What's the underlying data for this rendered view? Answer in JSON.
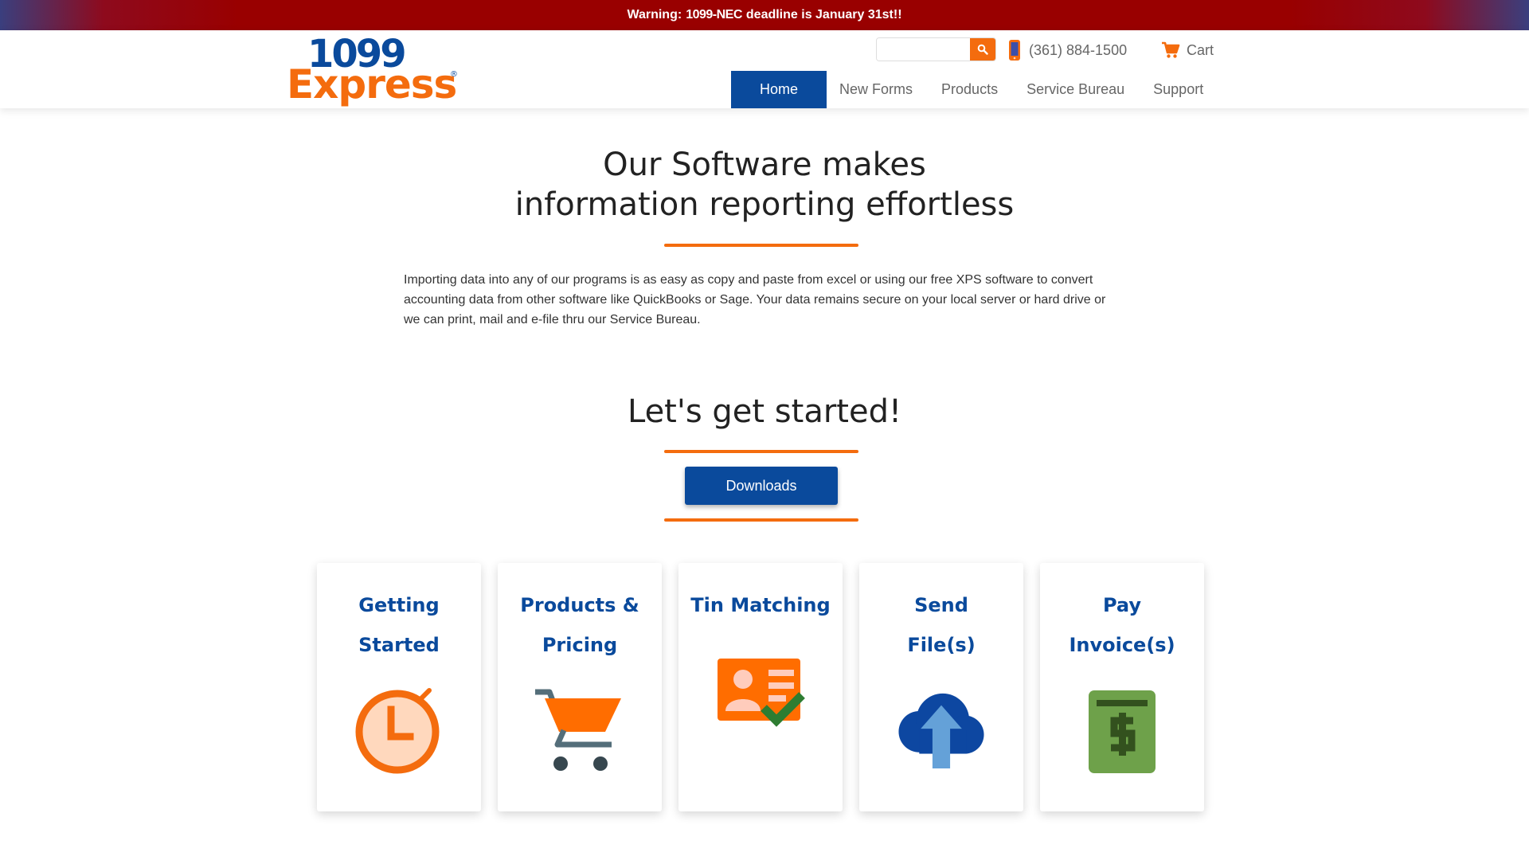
{
  "warning": {
    "prefix": "Warning:",
    "form": "1099-NEC",
    "suffix": "deadline is January 31st!!"
  },
  "header": {
    "logo": {
      "line1": "1099",
      "line2": "Express",
      "mark": "®"
    },
    "search": {
      "placeholder": "",
      "value": "",
      "button_icon": "search-icon"
    },
    "phone": {
      "icon": "phone-icon",
      "number": "(361) 884-1500"
    },
    "cart": {
      "icon": "cart-icon",
      "label": "Cart"
    },
    "nav": [
      {
        "label": "Home",
        "active": true
      },
      {
        "label": "New Forms",
        "active": false
      },
      {
        "label": "Products",
        "active": false
      },
      {
        "label": "Service Bureau",
        "active": false
      },
      {
        "label": "Support",
        "active": false
      }
    ]
  },
  "hero": {
    "title_line1": "Our Software makes",
    "title_line2": "information reporting effortless",
    "intro": "Importing data into any of our programs is as easy as copy and paste from excel or using our free XPS software to convert accounting data from other software like QuickBooks or Sage. Your data remains secure on your local server or hard drive or we can print, mail and e-file thru our Service Bureau."
  },
  "get_started": {
    "title": "Let's get started!",
    "button": "Downloads"
  },
  "cards": [
    {
      "line1": "Getting",
      "line2": "Started",
      "icon": "stopwatch-icon"
    },
    {
      "line1": "Products &",
      "line2": "Pricing",
      "icon": "shopping-cart-icon"
    },
    {
      "line1": "Tin Matching",
      "line2": "",
      "icon": "id-card-check-icon"
    },
    {
      "line1": "Send",
      "line2": "File(s)",
      "icon": "cloud-upload-icon"
    },
    {
      "line1": "Pay",
      "line2": "Invoice(s)",
      "icon": "invoice-dollar-icon"
    }
  ],
  "colors": {
    "brand_blue": "#0a4a9c",
    "brand_orange": "#f46c0e",
    "warning_red": "#990000"
  }
}
